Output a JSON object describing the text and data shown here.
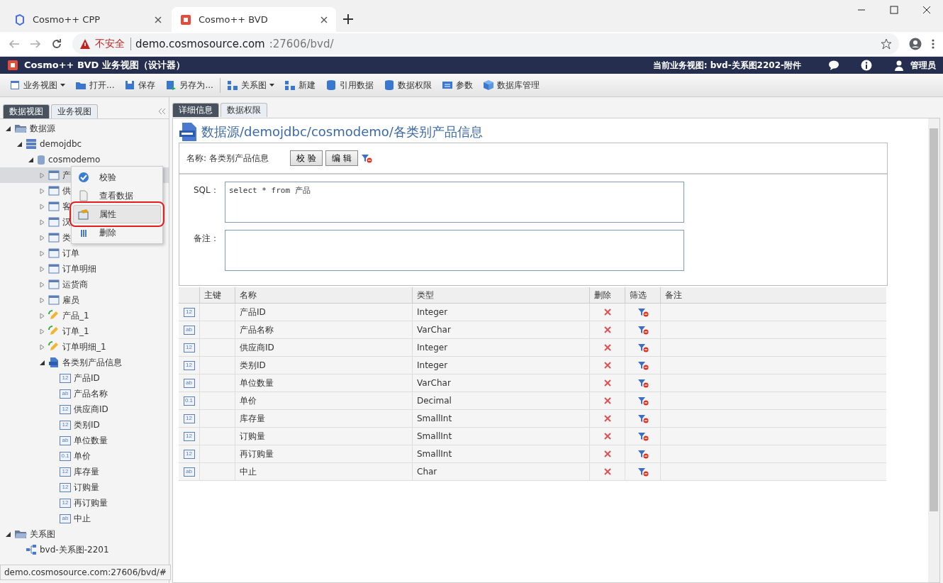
{
  "browser": {
    "tabs": [
      {
        "title": "Cosmo++ CPP",
        "selected": false,
        "kind": "cpp"
      },
      {
        "title": "Cosmo++ BVD",
        "selected": true,
        "kind": "bvd"
      }
    ],
    "security": "不安全",
    "url_host": "demo.cosmosource.com",
    "url_rest": ":27606/bvd/"
  },
  "header": {
    "title": "Cosmo++ BVD 业务视图（设计器）",
    "current_view": "当前业务视图: bvd-关系图2202-附件",
    "user": "管理员"
  },
  "toolbar": [
    [
      {
        "label": "业务视图",
        "kind": "view",
        "dropdown": true
      },
      {
        "label": "打开...",
        "kind": "open",
        "dropdown": false
      },
      {
        "label": "保存",
        "kind": "save",
        "dropdown": false
      },
      {
        "label": "另存为...",
        "kind": "saveas",
        "dropdown": false
      }
    ],
    [
      {
        "label": "关系图",
        "kind": "diagram",
        "dropdown": true
      },
      {
        "label": "新建",
        "kind": "new",
        "dropdown": false
      },
      {
        "label": "引用数据",
        "kind": "db",
        "dropdown": false
      },
      {
        "label": "数据权限",
        "kind": "db",
        "dropdown": false
      },
      {
        "label": "参数",
        "kind": "param",
        "dropdown": false
      },
      {
        "label": "数据库管理",
        "kind": "cube",
        "dropdown": false
      }
    ]
  ],
  "left_tabs": [
    {
      "label": "数据视图",
      "selected": true
    },
    {
      "label": "业务视图",
      "selected": false
    }
  ],
  "tree": [
    {
      "label": "数据源",
      "kind": "folder",
      "expanded": true,
      "selected": false,
      "children": [
        {
          "label": "demojdbc",
          "kind": "server",
          "expanded": true,
          "selected": false,
          "children": [
            {
              "label": "cosmodemo",
              "kind": "database",
              "expanded": true,
              "selected": false,
              "children": [
                {
                  "label": "产",
                  "kind": "table",
                  "expanded": false,
                  "selected": true
                },
                {
                  "label": "供",
                  "kind": "table",
                  "expanded": false,
                  "selected": false
                },
                {
                  "label": "客",
                  "kind": "table",
                  "expanded": false,
                  "selected": false
                },
                {
                  "label": "汉",
                  "kind": "table",
                  "expanded": false,
                  "selected": false
                },
                {
                  "label": "类",
                  "kind": "table",
                  "expanded": false,
                  "selected": false
                },
                {
                  "label": "订单",
                  "kind": "table",
                  "expanded": false,
                  "selected": false
                },
                {
                  "label": "订单明细",
                  "kind": "table",
                  "expanded": false,
                  "selected": false
                },
                {
                  "label": "运货商",
                  "kind": "table",
                  "expanded": false,
                  "selected": false
                },
                {
                  "label": "雇员",
                  "kind": "table",
                  "expanded": false,
                  "selected": false
                },
                {
                  "label": "产品_1",
                  "kind": "view",
                  "expanded": false,
                  "selected": false
                },
                {
                  "label": "订单_1",
                  "kind": "view",
                  "expanded": false,
                  "selected": false
                },
                {
                  "label": "订单明细_1",
                  "kind": "view",
                  "expanded": false,
                  "selected": false
                },
                {
                  "label": "各类别产品信息",
                  "kind": "sql",
                  "expanded": true,
                  "selected": false,
                  "children": [
                    {
                      "label": "产品ID",
                      "kind": "field",
                      "badge": "12",
                      "selected": false
                    },
                    {
                      "label": "产品名称",
                      "kind": "field",
                      "badge": "ab",
                      "selected": false
                    },
                    {
                      "label": "供应商ID",
                      "kind": "field",
                      "badge": "12",
                      "selected": false
                    },
                    {
                      "label": "类别ID",
                      "kind": "field",
                      "badge": "12",
                      "selected": false
                    },
                    {
                      "label": "单位数量",
                      "kind": "field",
                      "badge": "ab",
                      "selected": false
                    },
                    {
                      "label": "单价",
                      "kind": "field",
                      "badge": "0.1",
                      "selected": false
                    },
                    {
                      "label": "库存量",
                      "kind": "field",
                      "badge": "12",
                      "selected": false
                    },
                    {
                      "label": "订购量",
                      "kind": "field",
                      "badge": "12",
                      "selected": false
                    },
                    {
                      "label": "再订购量",
                      "kind": "field",
                      "badge": "12",
                      "selected": false
                    },
                    {
                      "label": "中止",
                      "kind": "field",
                      "badge": "ab",
                      "selected": false
                    }
                  ]
                }
              ]
            }
          ]
        }
      ]
    },
    {
      "label": "关系图",
      "kind": "folder",
      "expanded": true,
      "selected": false,
      "children": [
        {
          "label": "bvd-关系图-2201",
          "kind": "diagram",
          "selected": false
        }
      ]
    }
  ],
  "context_menu": [
    {
      "label": "校验",
      "kind": "check",
      "selected": false
    },
    {
      "label": "查看数据",
      "kind": "data",
      "selected": false
    },
    {
      "label": "属性",
      "kind": "props",
      "selected": true
    },
    {
      "label": "删除",
      "kind": "delete",
      "selected": false
    }
  ],
  "status_url": "demo.cosmosource.com:27606/bvd/#",
  "main_tabs": [
    {
      "label": "详细信息",
      "selected": true
    },
    {
      "label": "数据权限",
      "selected": false
    }
  ],
  "detail": {
    "path": "数据源/demojdbc/cosmodemo/各类别产品信息",
    "name_label": "名称: 各类别产品信息",
    "buttons": [
      "校 验",
      "编 辑"
    ],
    "sql_label": "SQL：",
    "sql": "select * from 产品",
    "note_label": "备注："
  },
  "table": {
    "columns": [
      "主键",
      "名称",
      "类型",
      "删除",
      "筛选",
      "备注"
    ],
    "rows": [
      {
        "badge": "12",
        "name": "产品ID",
        "type": "Integer"
      },
      {
        "badge": "ab",
        "name": "产品名称",
        "type": "VarChar"
      },
      {
        "badge": "12",
        "name": "供应商ID",
        "type": "Integer"
      },
      {
        "badge": "12",
        "name": "类别ID",
        "type": "Integer"
      },
      {
        "badge": "ab",
        "name": "单位数量",
        "type": "VarChar"
      },
      {
        "badge": "0.1",
        "name": "单价",
        "type": "Decimal"
      },
      {
        "badge": "12",
        "name": "库存量",
        "type": "SmallInt"
      },
      {
        "badge": "12",
        "name": "订购量",
        "type": "SmallInt"
      },
      {
        "badge": "12",
        "name": "再订购量",
        "type": "SmallInt"
      },
      {
        "badge": "ab",
        "name": "中止",
        "type": "Char"
      }
    ]
  }
}
